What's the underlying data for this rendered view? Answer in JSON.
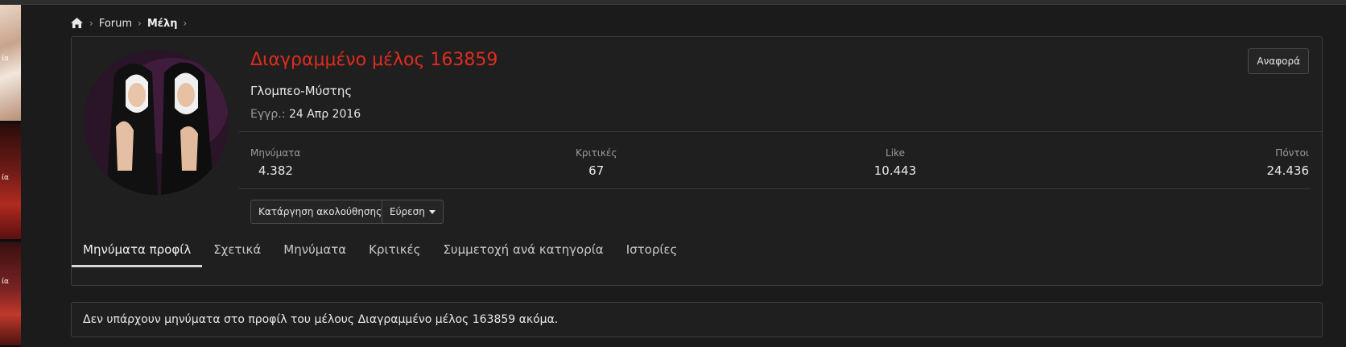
{
  "breadcrumb": {
    "home_icon": "home-icon",
    "items": [
      "Forum",
      "Μέλη"
    ]
  },
  "ads": {
    "texts": [
      "ία",
      "ία",
      "ία"
    ]
  },
  "profile": {
    "name": "Διαγραμμένο μέλος 163859",
    "user_title": "Γλομπεο-Μύστης",
    "joined_label": "Εγγρ.:",
    "joined_value": "24 Απρ 2016",
    "report_label": "Αναφορά",
    "stats": [
      {
        "label": "Μηνύματα",
        "value": "4.382"
      },
      {
        "label": "Κριτικές",
        "value": "67"
      },
      {
        "label": "Like",
        "value": "10.443"
      },
      {
        "label": "Πόντοι",
        "value": "24.436"
      }
    ],
    "unfollow_label": "Κατάργηση ακολούθησης",
    "find_label": "Εύρεση",
    "name_color": "#e02c1f"
  },
  "tabs": [
    {
      "label": "Μηνύματα προφίλ",
      "active": true
    },
    {
      "label": "Σχετικά",
      "active": false
    },
    {
      "label": "Μηνύματα",
      "active": false
    },
    {
      "label": "Κριτικές",
      "active": false
    },
    {
      "label": "Συμμετοχή ανά κατηγορία",
      "active": false
    },
    {
      "label": "Ιστορίες",
      "active": false
    }
  ],
  "empty_message": "Δεν υπάρχουν μηνύματα στο προφίλ του μέλους Διαγραμμένο μέλος 163859 ακόμα."
}
